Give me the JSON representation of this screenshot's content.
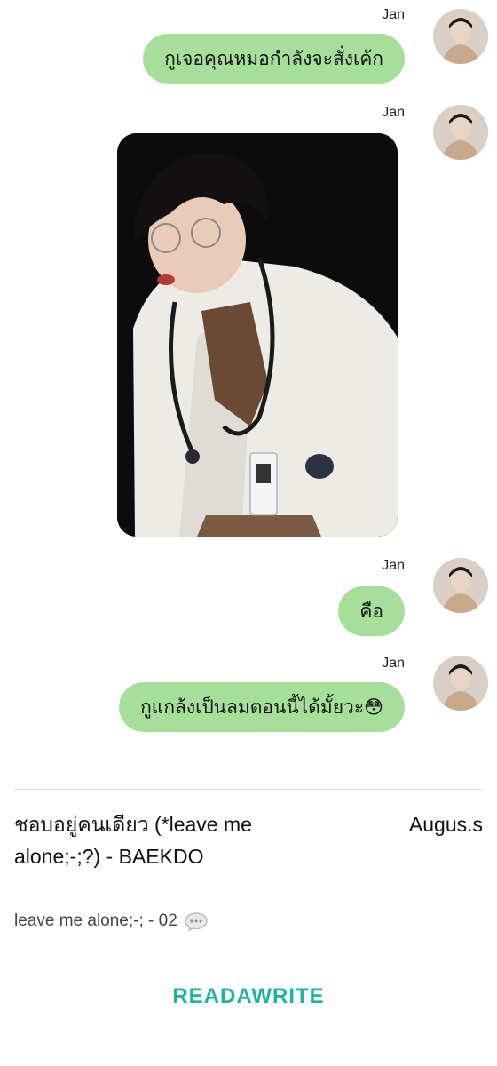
{
  "messages": [
    {
      "sender": "Jan",
      "text": "กูเจอคุณหมอกำลังจะสั่งเค้ก"
    },
    {
      "sender": "Jan",
      "type": "photo"
    },
    {
      "sender": "Jan",
      "text": "คือ"
    },
    {
      "sender": "Jan",
      "text": "กูแกล้งเป็นลมตอนนี้ได้มั้ยวะ😳"
    }
  ],
  "story": {
    "title": "ชอบอยู่คนเดียว (*leave me alone;-;?) - BAEKDO",
    "author": "Augus.s",
    "chapter": "leave me alone;-; - 02",
    "chapter_icon": "speech-bubble-icon"
  },
  "brand": {
    "logo_text": "READAWRITE",
    "color": "#1fb3a4"
  },
  "colors": {
    "bubble": "#a5df9a"
  }
}
